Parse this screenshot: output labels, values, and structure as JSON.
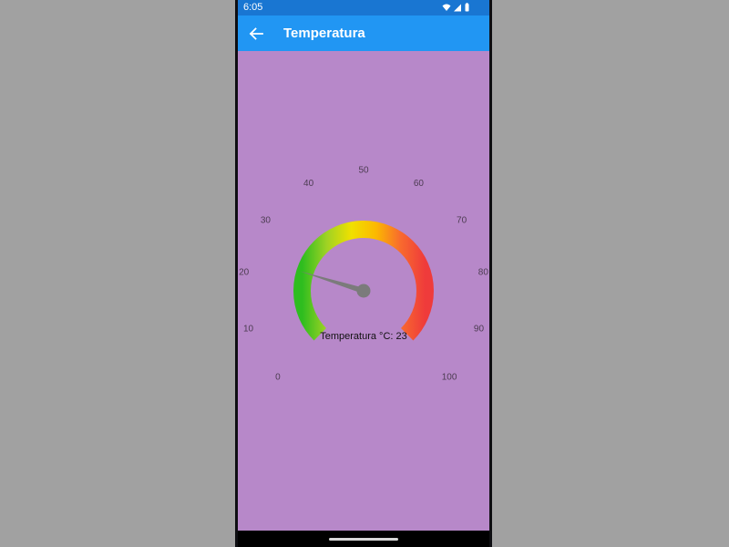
{
  "status_bar": {
    "time": "6:05",
    "icons": [
      "wifi-icon",
      "cellular-signal-icon",
      "battery-icon"
    ]
  },
  "app_bar": {
    "back_icon": "arrow-back-icon",
    "title": "Temperatura"
  },
  "gauge": {
    "min": 0,
    "max": 100,
    "value": 23,
    "tick_labels": [
      "0",
      "10",
      "20",
      "30",
      "40",
      "50",
      "60",
      "70",
      "80",
      "90",
      "100"
    ],
    "readout_label": "Temperatura °C: 23",
    "gradient_colors": [
      "#2ebd1f",
      "#9fd224",
      "#f0e000",
      "#fcb900",
      "#f86a2e",
      "#ef3b3b"
    ],
    "needle_color": "#7b7b7b",
    "tick_label_color": "#4d3c52"
  },
  "colors": {
    "app_bar": "#2196f3",
    "status_bar": "#1976d2",
    "background": "#b788c9"
  }
}
